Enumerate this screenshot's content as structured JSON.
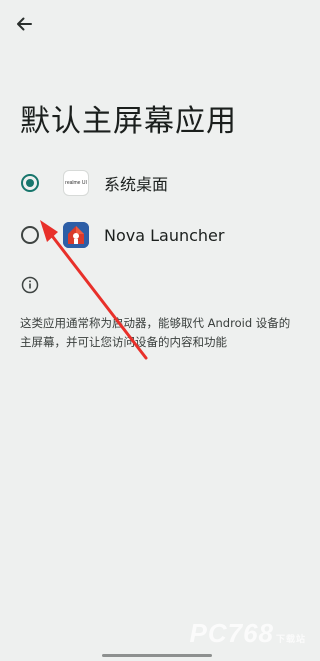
{
  "header": {
    "back_icon": "arrow-left-icon",
    "title": "默认主屏幕应用"
  },
  "options": [
    {
      "label": "系统桌面",
      "selected": true,
      "icon": "realme-launcher-icon",
      "icon_text": "realme UI"
    },
    {
      "label": "Nova Launcher",
      "selected": false,
      "icon": "nova-launcher-icon"
    }
  ],
  "info": {
    "icon": "info-icon",
    "text": "这类应用通常称为启动器，能够取代 Android 设备的主屏幕，并可让您访问设备的内容和功能"
  },
  "colors": {
    "background": "#eef0ef",
    "accent": "#17766c",
    "annotation_arrow": "#e8302a"
  },
  "watermark": {
    "text": "PC768",
    "sub": "下载站"
  }
}
